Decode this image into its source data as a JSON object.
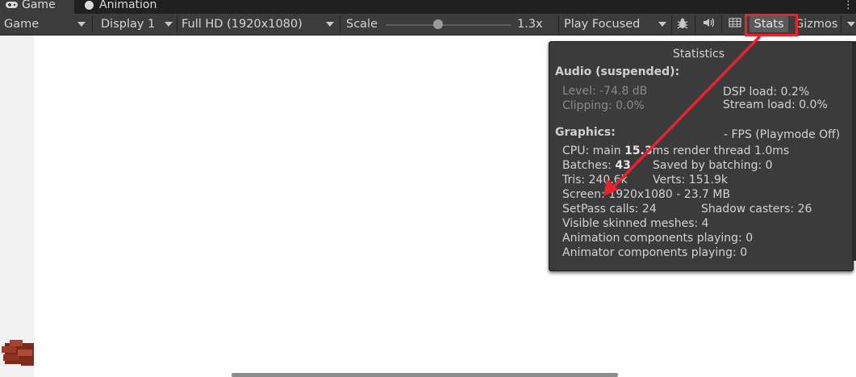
{
  "tabs": [
    {
      "label": "Game",
      "icon": "gamepad-icon"
    },
    {
      "label": "Animation",
      "icon": "animation-clock-icon"
    }
  ],
  "toolbar": {
    "view_mode": "Game",
    "display": "Display 1",
    "resolution": "Full HD (1920x1080)",
    "scale_label": "Scale",
    "scale_value": "1.3x",
    "play_mode": "Play Focused",
    "stats_label": "Stats",
    "gizmos_label": "Gizmos"
  },
  "stats": {
    "title": "Statistics",
    "audio_header": "Audio (suspended):",
    "level": "Level: -74.8 dB",
    "clipping": "Clipping: 0.0%",
    "dsp_load": "DSP load: 0.2%",
    "stream_load": "Stream load: 0.0%",
    "graphics_header": "Graphics:",
    "fps": "- FPS (Playmode Off)",
    "cpu_prefix": "CPU: main ",
    "cpu_main": "15.3",
    "cpu_suffix": "ms  render thread 1.0ms",
    "batches_prefix": "Batches: ",
    "batches": "43",
    "saved_by_batching": "Saved by batching: 0",
    "tris": "Tris: 240.6k",
    "verts": "Verts: 151.9k",
    "screen": "Screen: 1920x1080 - 23.7 MB",
    "setpass": "SetPass calls: 24",
    "shadow_casters": "Shadow casters: 26",
    "skinned_meshes": "Visible skinned meshes: 4",
    "animation_components": "Animation components playing: 0",
    "animator_components": "Animator components playing: 0"
  },
  "colors": {
    "annotation": "#e8232e",
    "toolbar_bg": "#3c3c3c",
    "panel_bg": "#3b3b3b"
  }
}
